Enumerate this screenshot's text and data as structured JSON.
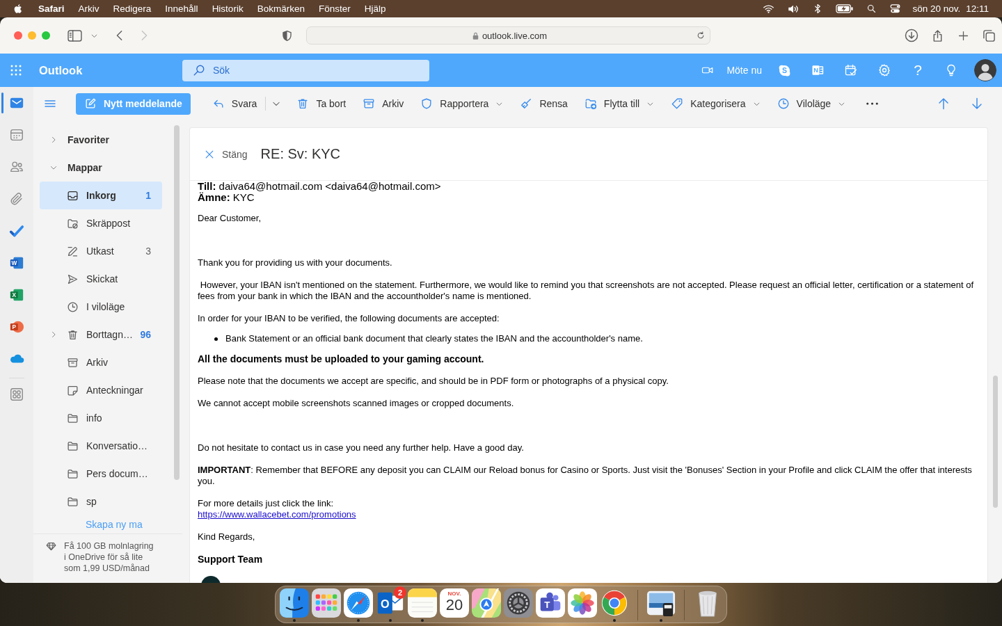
{
  "menu_bar": {
    "app": "Safari",
    "menus": [
      "Arkiv",
      "Redigera",
      "Innehåll",
      "Historik",
      "Bokmärken",
      "Fönster",
      "Hjälp"
    ],
    "date": "sön 20 nov.",
    "time": "12:11"
  },
  "browser": {
    "back": {
      "disabled": false
    },
    "forward": {
      "disabled": true
    },
    "address": "outlook.live.com"
  },
  "outlook_header": {
    "app_name": "Outlook",
    "search": {
      "placeholder": "Sök"
    },
    "meet_now": "Möte nu",
    "app_letters": [
      "S",
      "N"
    ],
    "help": "?"
  },
  "rail": {
    "items": [
      {
        "selected": true
      },
      {
        "selected": false
      },
      {
        "selected": false
      },
      {
        "selected": false
      },
      {
        "selected": false
      },
      {
        "selected": false,
        "letter": "W"
      },
      {
        "selected": false,
        "letter": "X"
      },
      {
        "selected": false,
        "letter": "P"
      },
      {
        "selected": false
      },
      {
        "selected": false
      }
    ]
  },
  "command_bar": {
    "new_message": "Nytt meddelande",
    "commands": [
      {
        "label": "Svara",
        "kind": "split"
      },
      {
        "label": "Ta bort",
        "kind": "plain"
      },
      {
        "label": "Arkiv",
        "kind": "plain"
      },
      {
        "label": "Rapportera",
        "kind": "dropdown"
      },
      {
        "label": "Rensa",
        "kind": "plain"
      },
      {
        "label": "Flytta till",
        "kind": "dropdown"
      },
      {
        "label": "Kategorisera",
        "kind": "dropdown"
      },
      {
        "label": "Viloläge",
        "kind": "dropdown"
      }
    ]
  },
  "folder_pane": {
    "tree": [
      {
        "label": "Favoriter",
        "expanded": false
      },
      {
        "label": "Mappar",
        "expanded": true,
        "children": [
          {
            "label": "Inkorg",
            "kind": "inbox",
            "selected": true,
            "count": "1",
            "unread": true
          },
          {
            "label": "Skräppost",
            "kind": "junk",
            "selected": false
          },
          {
            "label": "Utkast",
            "kind": "drafts",
            "selected": false,
            "count": "3",
            "unread": false
          },
          {
            "label": "Skickat",
            "kind": "sent",
            "selected": false
          },
          {
            "label": "I viloläge",
            "kind": "snoozed",
            "selected": false
          },
          {
            "label": "Borttagn…",
            "kind": "deleted",
            "selected": false,
            "expanded": false,
            "count": "96",
            "unread": true
          },
          {
            "label": "Arkiv",
            "kind": "archive",
            "selected": false
          },
          {
            "label": "Anteckningar",
            "kind": "notes",
            "selected": false
          },
          {
            "label": "info",
            "kind": "folder",
            "selected": false
          },
          {
            "label": "Konversatio…",
            "kind": "folder",
            "selected": false
          },
          {
            "label": "Pers docum…",
            "kind": "folder",
            "selected": false
          },
          {
            "label": "sp",
            "kind": "folder",
            "selected": false
          }
        ]
      }
    ],
    "new_folder": "Skapa ny ma",
    "promo": "Få 100 GB molnlagring i OneDrive för så lite som 1,99 USD/månad"
  },
  "reading_pane": {
    "close": "Stäng",
    "subject": "RE: Sv: KYC",
    "body": [
      {
        "kind": "field",
        "text": "**Till:** daiva64@hotmail.com <daiva64@hotmail.com>"
      },
      {
        "kind": "field",
        "text": "**Ämne:** KYC"
      },
      {
        "kind": "paragraph",
        "text": "Dear Customer,"
      },
      {
        "kind": "break"
      },
      {
        "kind": "paragraph",
        "text": "Thank you for providing us with your documents."
      },
      {
        "kind": "paragraph",
        "text": " However, your IBAN isn't mentioned on the statement. Furthermore, we would like to remind you that screenshots are not accepted. Please request an official letter, certification or a statement of fees from your bank in which the IBAN and the accountholder's name is mentioned."
      },
      {
        "kind": "paragraph",
        "text": "In order for your IBAN to be verified, the following documents are accepted:"
      },
      {
        "kind": "bullet",
        "text": "Bank Statement or an official bank document that clearly states the IBAN and the accountholder's name."
      },
      {
        "kind": "strong",
        "text": "All the documents must be uploaded to your gaming account."
      },
      {
        "kind": "paragraph",
        "text": "Please note that the documents we accept are specific, and should be in PDF form or photographs of a physical copy."
      },
      {
        "kind": "paragraph",
        "text": "We cannot accept mobile screenshots scanned images or cropped documents."
      },
      {
        "kind": "break"
      },
      {
        "kind": "paragraph",
        "text": "Do not hesitate to contact us in case you need any further help. Have a good day."
      },
      {
        "kind": "paragraph",
        "text": "**IMPORTANT**: Remember that BEFORE any deposit you can CLAIM our Reload bonus for Casino or Sports. Just visit the 'Bonuses' Section in your Profile and click CLAIM the offer that interests you."
      },
      {
        "kind": "paragraph",
        "text": "For more details just click the link:",
        "link": "https://www.wallacebet.com/promotions"
      },
      {
        "kind": "paragraph",
        "text": "Kind Regards,"
      },
      {
        "kind": "strong",
        "text": "Support Team"
      },
      {
        "kind": "logo"
      }
    ]
  },
  "dock": {
    "apps": [
      {
        "running": true
      },
      {
        "running": false
      },
      {
        "running": true
      },
      {
        "running": true,
        "letter": "O",
        "badge": "2"
      },
      {
        "running": true
      },
      {
        "running": false,
        "month": "NOV.",
        "day": "20"
      },
      {
        "running": false
      },
      {
        "running": false
      },
      {
        "running": false,
        "letter": "T"
      },
      {
        "running": false
      },
      {
        "running": true
      }
    ],
    "documents": [
      {
        "running": true
      }
    ],
    "trash": {
      "running": false
    }
  }
}
